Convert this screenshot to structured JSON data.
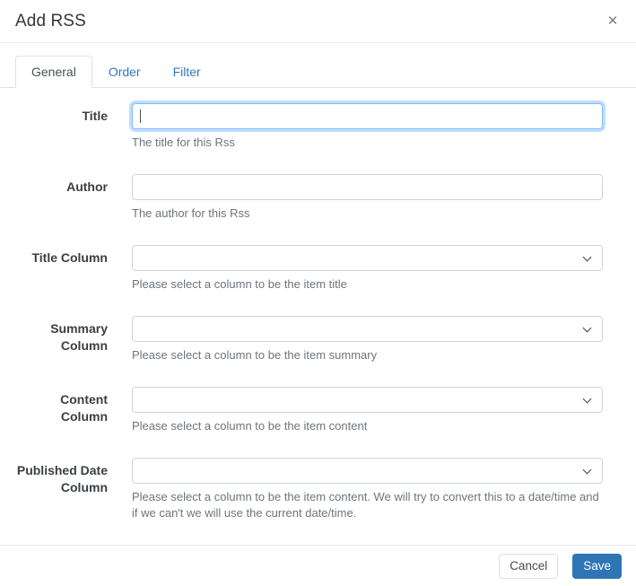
{
  "modal": {
    "title": "Add RSS",
    "close_icon": "✕"
  },
  "tabs": [
    {
      "label": "General",
      "active": true
    },
    {
      "label": "Order",
      "active": false
    },
    {
      "label": "Filter",
      "active": false
    }
  ],
  "form": {
    "fields": [
      {
        "label": "Title",
        "type": "text",
        "value": "",
        "placeholder": "",
        "focused": true,
        "help": "The title for this Rss"
      },
      {
        "label": "Author",
        "type": "text",
        "value": "",
        "placeholder": "",
        "focused": false,
        "help": "The author for this Rss"
      },
      {
        "label": "Title Column",
        "type": "select",
        "value": "",
        "help": "Please select a column to be the item title"
      },
      {
        "label": "Summary Column",
        "type": "select",
        "value": "",
        "help": "Please select a column to be the item summary"
      },
      {
        "label": "Content Column",
        "type": "select",
        "value": "",
        "help": "Please select a column to be the item content"
      },
      {
        "label": "Published Date Column",
        "type": "select",
        "value": "",
        "help": "Please select a column to be the item content. We will try to convert this to a date/time and if we can't we will use the current date/time."
      }
    ]
  },
  "footer": {
    "cancel_label": "Cancel",
    "save_label": "Save"
  },
  "colors": {
    "accent": "#2e75b6",
    "tab_link": "#3079c0",
    "focus_ring": "#80bdff",
    "muted_text": "#6c757d",
    "border": "#dee2e6"
  }
}
